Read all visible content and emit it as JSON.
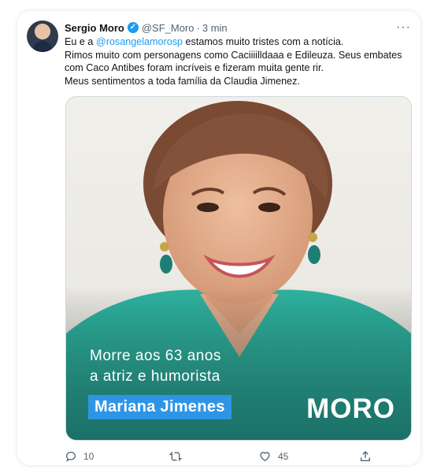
{
  "tweet": {
    "author_name": "Sergio Moro",
    "verified_icon": "verified-badge-icon",
    "handle": "@SF_Moro",
    "separator": "·",
    "time": "3 min",
    "more_icon": "···",
    "text": {
      "line1_prefix": "Eu e a ",
      "mention": "@rosangelamorosp",
      "line1_suffix": " estamos muito tristes com a notícia.",
      "line2": "Rimos muito com personagens como Caciiiilldaaa e Edileuza. Seus embates",
      "line3": "com Caco Antibes foram incríveis e fizeram muita gente rir.",
      "line4": "Meus sentimentos a toda família da Claudia Jimenez."
    },
    "media": {
      "overlay_line1": "Morre aos 63 anos",
      "overlay_line2": "a atriz e humorista",
      "name_label": "Mariana Jimenes",
      "brand": "MORO",
      "colors": {
        "teal": "#2fb3a0",
        "label_blue": "#2e95e6"
      }
    },
    "actions": {
      "reply_count": "10",
      "retweet_count": "",
      "like_count": "45",
      "share_count": ""
    }
  }
}
